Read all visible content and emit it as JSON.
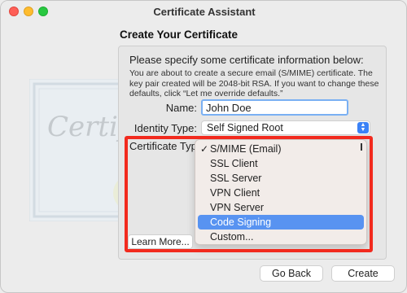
{
  "window": {
    "title": "Certificate Assistant"
  },
  "heading": "Create Your Certificate",
  "art": {
    "watermark_text": "Certificate"
  },
  "prompt": "Please specify some certificate information below:",
  "description": "You are about to create a secure email (S/MIME) certificate. The key pair created will be 2048-bit RSA. If you want to change these defaults, click “Let me override defaults.”",
  "form": {
    "name_label": "Name:",
    "name_value": "John Doe",
    "identity_type_label": "Identity Type:",
    "identity_type_value": "Self Signed Root",
    "certificate_type_label": "Certificate Type"
  },
  "dropdown": {
    "items": [
      {
        "label": "S/MIME (Email)",
        "checked": true,
        "highlighted": false
      },
      {
        "label": "SSL Client",
        "checked": false,
        "highlighted": false
      },
      {
        "label": "SSL Server",
        "checked": false,
        "highlighted": false
      },
      {
        "label": "VPN Client",
        "checked": false,
        "highlighted": false
      },
      {
        "label": "VPN Server",
        "checked": false,
        "highlighted": false
      },
      {
        "label": "Code Signing",
        "checked": false,
        "highlighted": true
      },
      {
        "label": "Custom...",
        "checked": false,
        "highlighted": false
      }
    ],
    "check_glyph": "✓"
  },
  "buttons": {
    "learn_more": "Learn More...",
    "go_back": "Go Back",
    "create": "Create"
  },
  "colors": {
    "accent": "#5893f1",
    "highlight_box": "#f22a1e",
    "focus_ring": "#7ab0f3"
  }
}
